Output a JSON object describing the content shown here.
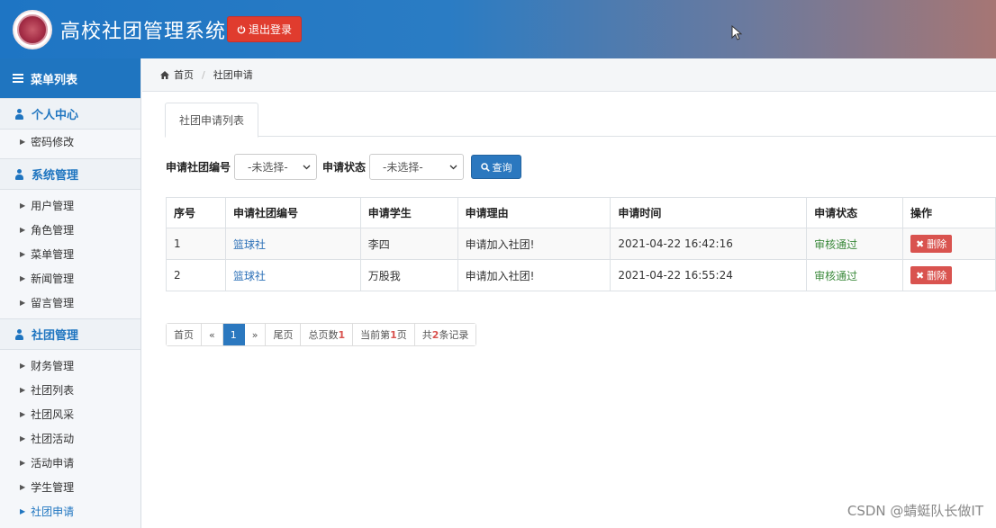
{
  "header": {
    "title": "高校社团管理系统",
    "logout_label": "退出登录"
  },
  "sidebar": {
    "menu_title": "菜单列表",
    "groups": [
      {
        "label": "个人中心",
        "items": [
          "密码修改"
        ]
      },
      {
        "label": "系统管理",
        "items": [
          "用户管理",
          "角色管理",
          "菜单管理",
          "新闻管理",
          "留言管理"
        ]
      },
      {
        "label": "社团管理",
        "items": [
          "财务管理",
          "社团列表",
          "社团风采",
          "社团活动",
          "活动申请",
          "学生管理",
          "社团申请"
        ]
      }
    ],
    "active_item": "社团申请"
  },
  "breadcrumb": {
    "home": "首页",
    "current": "社团申请"
  },
  "tab": {
    "label": "社团申请列表"
  },
  "filter": {
    "club_label": "申请社团编号",
    "club_value": "-未选择-",
    "status_label": "申请状态",
    "status_value": "-未选择-",
    "query_label": "查询"
  },
  "table": {
    "headers": [
      "序号",
      "申请社团编号",
      "申请学生",
      "申请理由",
      "申请时间",
      "申请状态",
      "操作"
    ],
    "rows": [
      {
        "no": "1",
        "club": "篮球社",
        "student": "李四",
        "reason": "申请加入社团!",
        "time": "2021-04-22 16:42:16",
        "status": "审核通过",
        "action": "删除"
      },
      {
        "no": "2",
        "club": "篮球社",
        "student": "万股我",
        "reason": "申请加入社团!",
        "time": "2021-04-22 16:55:24",
        "status": "审核通过",
        "action": "删除"
      }
    ]
  },
  "pager": {
    "first": "首页",
    "prev": "«",
    "current": "1",
    "next": "»",
    "last": "尾页",
    "total_pages_label": "总页数",
    "total_pages": "1",
    "current_page_prefix": "当前第",
    "current_page": "1",
    "current_page_suffix": "页",
    "records_prefix": "共",
    "records": "2",
    "records_suffix": "条记录"
  },
  "watermark": "CSDN @蜻蜓队长做IT",
  "colors": {
    "primary": "#1f75c0",
    "danger": "#d9534f",
    "success": "#3c8a3c"
  }
}
